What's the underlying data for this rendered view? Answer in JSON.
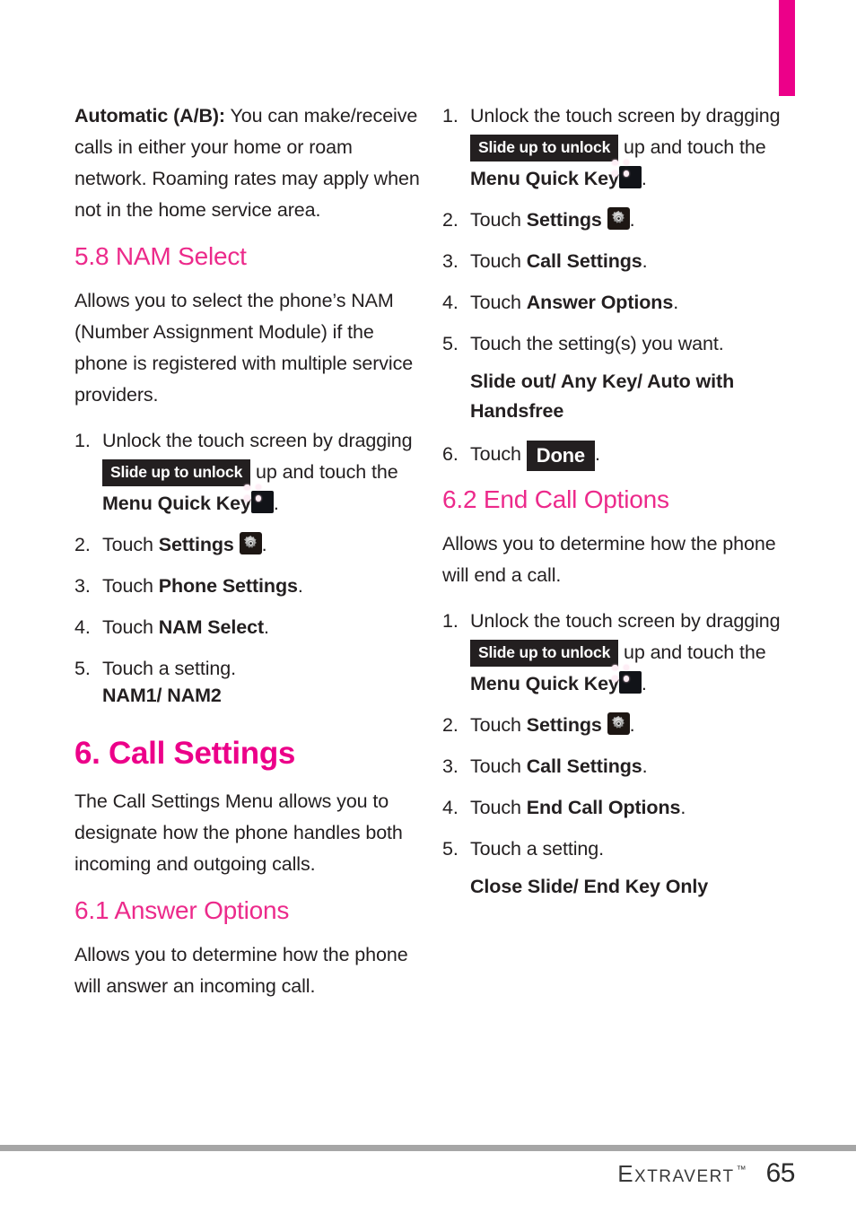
{
  "page": {
    "number": "65",
    "brand": "Extravert",
    "trademark": "™",
    "accent_heading": "#ec2a8b",
    "accent_chapter": "#ec0089",
    "tab_color": "#ec0089",
    "badge_bg": "#231f20",
    "rule_color": "#a6a6a6"
  },
  "left_column": {
    "automatic_label": "Automatic (A/B):",
    "automatic_text": " You can make/receive calls in either your home or roam network. Roaming rates may apply when not in the home service area.",
    "nam_select": {
      "heading": "5.8 NAM Select",
      "intro": "Allows you to select the phone’s NAM (Number Assignment Module) if the phone is registered with multiple service providers.",
      "steps": [
        {
          "num": "1.",
          "pre": "Unlock the touch screen by dragging ",
          "badge": "Slide up to unlock",
          "mid": " up and touch the ",
          "bold": "Menu Quick Key",
          "icon": "menu-quick-key-icon",
          "post": "."
        },
        {
          "num": "2.",
          "pre": "Touch ",
          "bold": "Settings",
          "icon": "settings-gear-icon",
          "post": "."
        },
        {
          "num": "3.",
          "pre": "Touch ",
          "bold": "Phone Settings",
          "post": "."
        },
        {
          "num": "4.",
          "pre": "Touch ",
          "bold": "NAM Select",
          "post": "."
        },
        {
          "num": "5.",
          "pre": "Touch a setting.",
          "post": ""
        }
      ],
      "setting_values": "NAM1/ NAM2"
    },
    "call_settings": {
      "heading": "6. Call Settings",
      "intro": "The Call Settings Menu allows you to designate how the phone handles both incoming and outgoing calls."
    },
    "answer_options": {
      "heading": "6.1 Answer Options",
      "intro": "Allows you to determine how the phone will answer an incoming call."
    }
  },
  "right_column": {
    "answer_options_steps": [
      {
        "num": "1.",
        "pre": "Unlock the touch screen by dragging ",
        "badge": "Slide up to unlock",
        "mid": " up and touch the ",
        "bold": "Menu Quick Key",
        "icon": "menu-quick-key-icon",
        "post": "."
      },
      {
        "num": "2.",
        "pre": "Touch ",
        "bold": "Settings",
        "icon": "settings-gear-icon",
        "post": "."
      },
      {
        "num": "3.",
        "pre": "Touch ",
        "bold": "Call Settings",
        "post": "."
      },
      {
        "num": "4.",
        "pre": "Touch ",
        "bold": "Answer Options",
        "post": "."
      },
      {
        "num": "5.",
        "pre": "Touch the setting(s) you want.",
        "post": ""
      }
    ],
    "answer_setting_values": "Slide out/ Any Key/ Auto with Handsfree",
    "done_step": {
      "num": "6.",
      "pre": "Touch ",
      "badge": "Done",
      "post": "."
    },
    "end_call_options": {
      "heading": "6.2 End Call Options",
      "intro": "Allows you to determine how the phone will end a call.",
      "steps": [
        {
          "num": "1.",
          "pre": "Unlock the touch screen by dragging ",
          "badge": "Slide up to unlock",
          "mid": " up and touch the ",
          "bold": "Menu Quick Key",
          "icon": "menu-quick-key-icon",
          "post": "."
        },
        {
          "num": "2.",
          "pre": "Touch ",
          "bold": "Settings",
          "icon": "settings-gear-icon",
          "post": "."
        },
        {
          "num": "3.",
          "pre": "Touch ",
          "bold": "Call Settings",
          "post": "."
        },
        {
          "num": "4.",
          "pre": "Touch ",
          "bold": "End Call Options",
          "post": "."
        },
        {
          "num": "5.",
          "pre": "Touch a setting.",
          "post": ""
        }
      ],
      "setting_values": "Close Slide/ End Key Only"
    }
  }
}
